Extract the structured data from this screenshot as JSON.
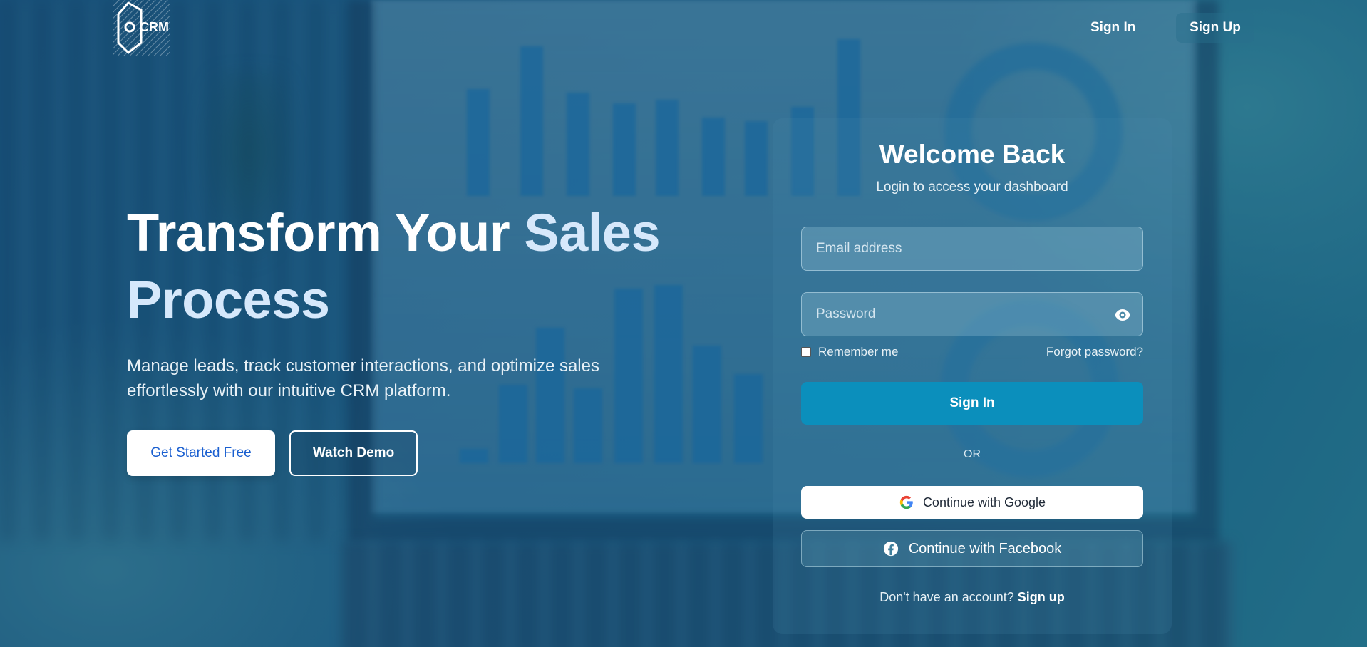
{
  "brand": {
    "logo_text": "CRM"
  },
  "nav": {
    "sign_in": "Sign In",
    "sign_up": "Sign Up"
  },
  "hero": {
    "title_part1": "Transform Your ",
    "title_accent": "Sales Process",
    "subtitle": "Manage leads, track customer interactions, and optimize sales effortlessly with our intuitive CRM platform.",
    "primary_cta": "Get Started Free",
    "secondary_cta": "Watch Demo"
  },
  "login": {
    "title": "Welcome Back",
    "subtitle": "Login to access your dashboard",
    "email_placeholder": "Email address",
    "password_placeholder": "Password",
    "remember_label": "Remember me",
    "forgot_label": "Forgot password?",
    "submit_label": "Sign In",
    "divider_label": "OR",
    "google_label": "Continue with Google",
    "facebook_label": "Continue with Facebook",
    "no_account_text": "Don't have an account?",
    "signup_link": "Sign up"
  },
  "icons": {
    "logo": "crm-logo-icon",
    "eye": "eye-icon",
    "google": "google-icon",
    "facebook": "facebook-icon"
  },
  "colors": {
    "primary_button": "#0b8fbc",
    "accent_text": "#d6e8fb",
    "cta_text": "#1a5fd0"
  }
}
